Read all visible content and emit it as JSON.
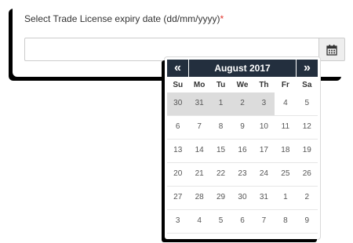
{
  "form": {
    "label": "Select Trade License expiry date (dd/mm/yyyy)",
    "required_mark": "*",
    "input_value": "",
    "calendar_button_icon": "calendar-icon"
  },
  "datepicker": {
    "prev_label": "«",
    "next_label": "»",
    "month_year": "August 2017",
    "weekdays": [
      "Su",
      "Mo",
      "Tu",
      "We",
      "Th",
      "Fr",
      "Sa"
    ],
    "weeks": [
      [
        "30",
        "31",
        "1",
        "2",
        "3",
        "4",
        "5"
      ],
      [
        "6",
        "7",
        "8",
        "9",
        "10",
        "11",
        "12"
      ],
      [
        "13",
        "14",
        "15",
        "16",
        "17",
        "18",
        "19"
      ],
      [
        "20",
        "21",
        "22",
        "23",
        "24",
        "25",
        "26"
      ],
      [
        "27",
        "28",
        "29",
        "30",
        "31",
        "1",
        "2"
      ],
      [
        "3",
        "4",
        "5",
        "6",
        "7",
        "8",
        "9"
      ]
    ],
    "shaded_days": [
      [
        0,
        0
      ],
      [
        0,
        1
      ],
      [
        0,
        2
      ],
      [
        0,
        3
      ],
      [
        0,
        4
      ]
    ],
    "colors": {
      "header_bg": "#232f3e",
      "required": "#e2352d",
      "shaded_bg": "#dcdcdc"
    }
  }
}
